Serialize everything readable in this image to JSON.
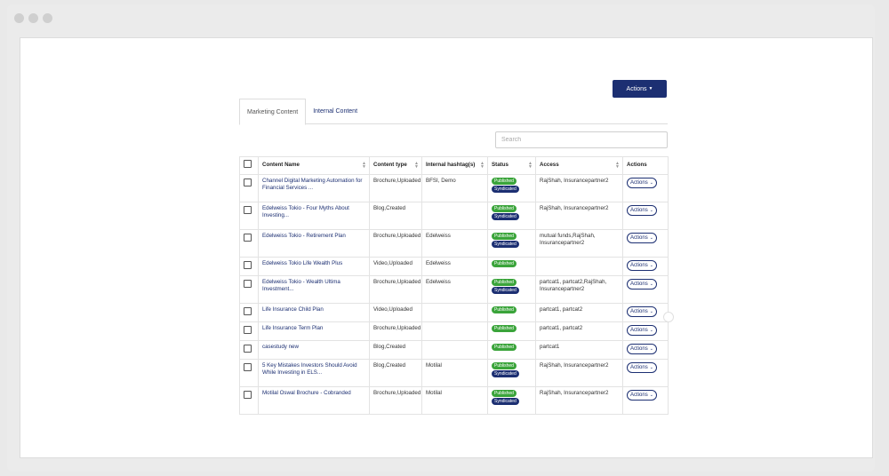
{
  "toolbar": {
    "actions_label": "Actions"
  },
  "tabs": [
    {
      "label": "Marketing Content"
    },
    {
      "label": "Internal Content"
    }
  ],
  "search": {
    "placeholder": "Search"
  },
  "table": {
    "headers": [
      "Content Name",
      "Content type",
      "Internal hashtag(s)",
      "Status",
      "Access",
      "Actions"
    ],
    "action_label": "Actions",
    "rows": [
      {
        "name_1": "Channel Digital Marketing Automation for",
        "name_2": "Financial Services ...",
        "type": "Brochure,Uploaded",
        "hashtag": "BFSI, Demo",
        "s1": "Published",
        "s2": "Syndicated",
        "access_1": "RajShah, Insurancepartner2",
        "access_2": ""
      },
      {
        "name_1": "Edelweiss Tokio - Four Myths About",
        "name_2": "Investing...",
        "type": "Blog,Created",
        "hashtag": "",
        "s1": "Published",
        "s2": "Syndicated",
        "access_1": "RajShah, Insurancepartner2",
        "access_2": ""
      },
      {
        "name_1": "Edelweiss Tokio - Retirement Plan",
        "name_2": "",
        "type": "Brochure,Uploaded",
        "hashtag": "Edelweiss",
        "s1": "Published",
        "s2": "Syndicated",
        "access_1": "mutual funds,RajShah,",
        "access_2": "Insurancepartner2"
      },
      {
        "name_1": "Edelweiss Tokio Life Wealth Plus",
        "name_2": "",
        "type": "Video,Uploaded",
        "hashtag": "Edelweiss",
        "s1": "Published",
        "s2": "",
        "access_1": "",
        "access_2": ""
      },
      {
        "name_1": "Edelweiss Tokio - Wealth Ultima",
        "name_2": "Investment...",
        "type": "Brochure,Uploaded",
        "hashtag": "Edelweiss",
        "s1": "Published",
        "s2": "Syndicated",
        "access_1": "partcat1, partcat2,RajShah,",
        "access_2": "Insurancepartner2"
      },
      {
        "name_1": "Life Insurance Child Plan",
        "name_2": "",
        "type": "Video,Uploaded",
        "hashtag": "",
        "s1": "Published",
        "s2": "",
        "access_1": "partcat1, partcat2",
        "access_2": ""
      },
      {
        "name_1": "Life Insurance Term Plan",
        "name_2": "",
        "type": "Brochure,Uploaded",
        "hashtag": "",
        "s1": "Published",
        "s2": "",
        "access_1": "partcat1, partcat2",
        "access_2": ""
      },
      {
        "name_1": "casestudy new",
        "name_2": "",
        "type": "Blog,Created",
        "hashtag": "",
        "s1": "Published",
        "s2": "",
        "access_1": "partcat1",
        "access_2": ""
      },
      {
        "name_1": "5 Key Mistakes Investors Should Avoid",
        "name_2": "While Investing in ELS...",
        "type": "Blog,Created",
        "hashtag": "Motilal",
        "s1": "Published",
        "s2": "Syndicated",
        "access_1": "RajShah, Insurancepartner2",
        "access_2": ""
      },
      {
        "name_1": "Motilal Oswal Brochure - Cobranded",
        "name_2": "",
        "type": "Brochure,Uploaded",
        "hashtag": "Motilal",
        "s1": "Published",
        "s2": "Syndicated",
        "access_1": "RajShah, Insurancepartner2",
        "access_2": ""
      }
    ]
  }
}
